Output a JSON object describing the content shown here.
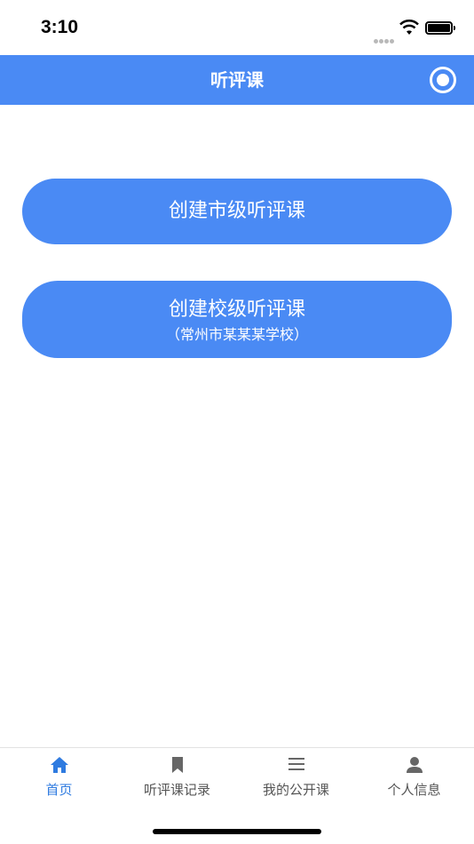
{
  "status_bar": {
    "time": "3:10"
  },
  "nav": {
    "title": "听评课"
  },
  "buttons": {
    "city_label": "创建市级听评课",
    "school_label": "创建校级听评课",
    "school_sub": "（常州市某某某学校）"
  },
  "tabs": [
    {
      "label": "首页",
      "icon": "home-icon",
      "active": true
    },
    {
      "label": "听评课记录",
      "icon": "bookmark-icon",
      "active": false
    },
    {
      "label": "我的公开课",
      "icon": "list-icon",
      "active": false
    },
    {
      "label": "个人信息",
      "icon": "person-icon",
      "active": false
    }
  ],
  "colors": {
    "accent": "#4a8af4",
    "active_tab": "#2f7be0",
    "inactive_tab": "#555555"
  }
}
